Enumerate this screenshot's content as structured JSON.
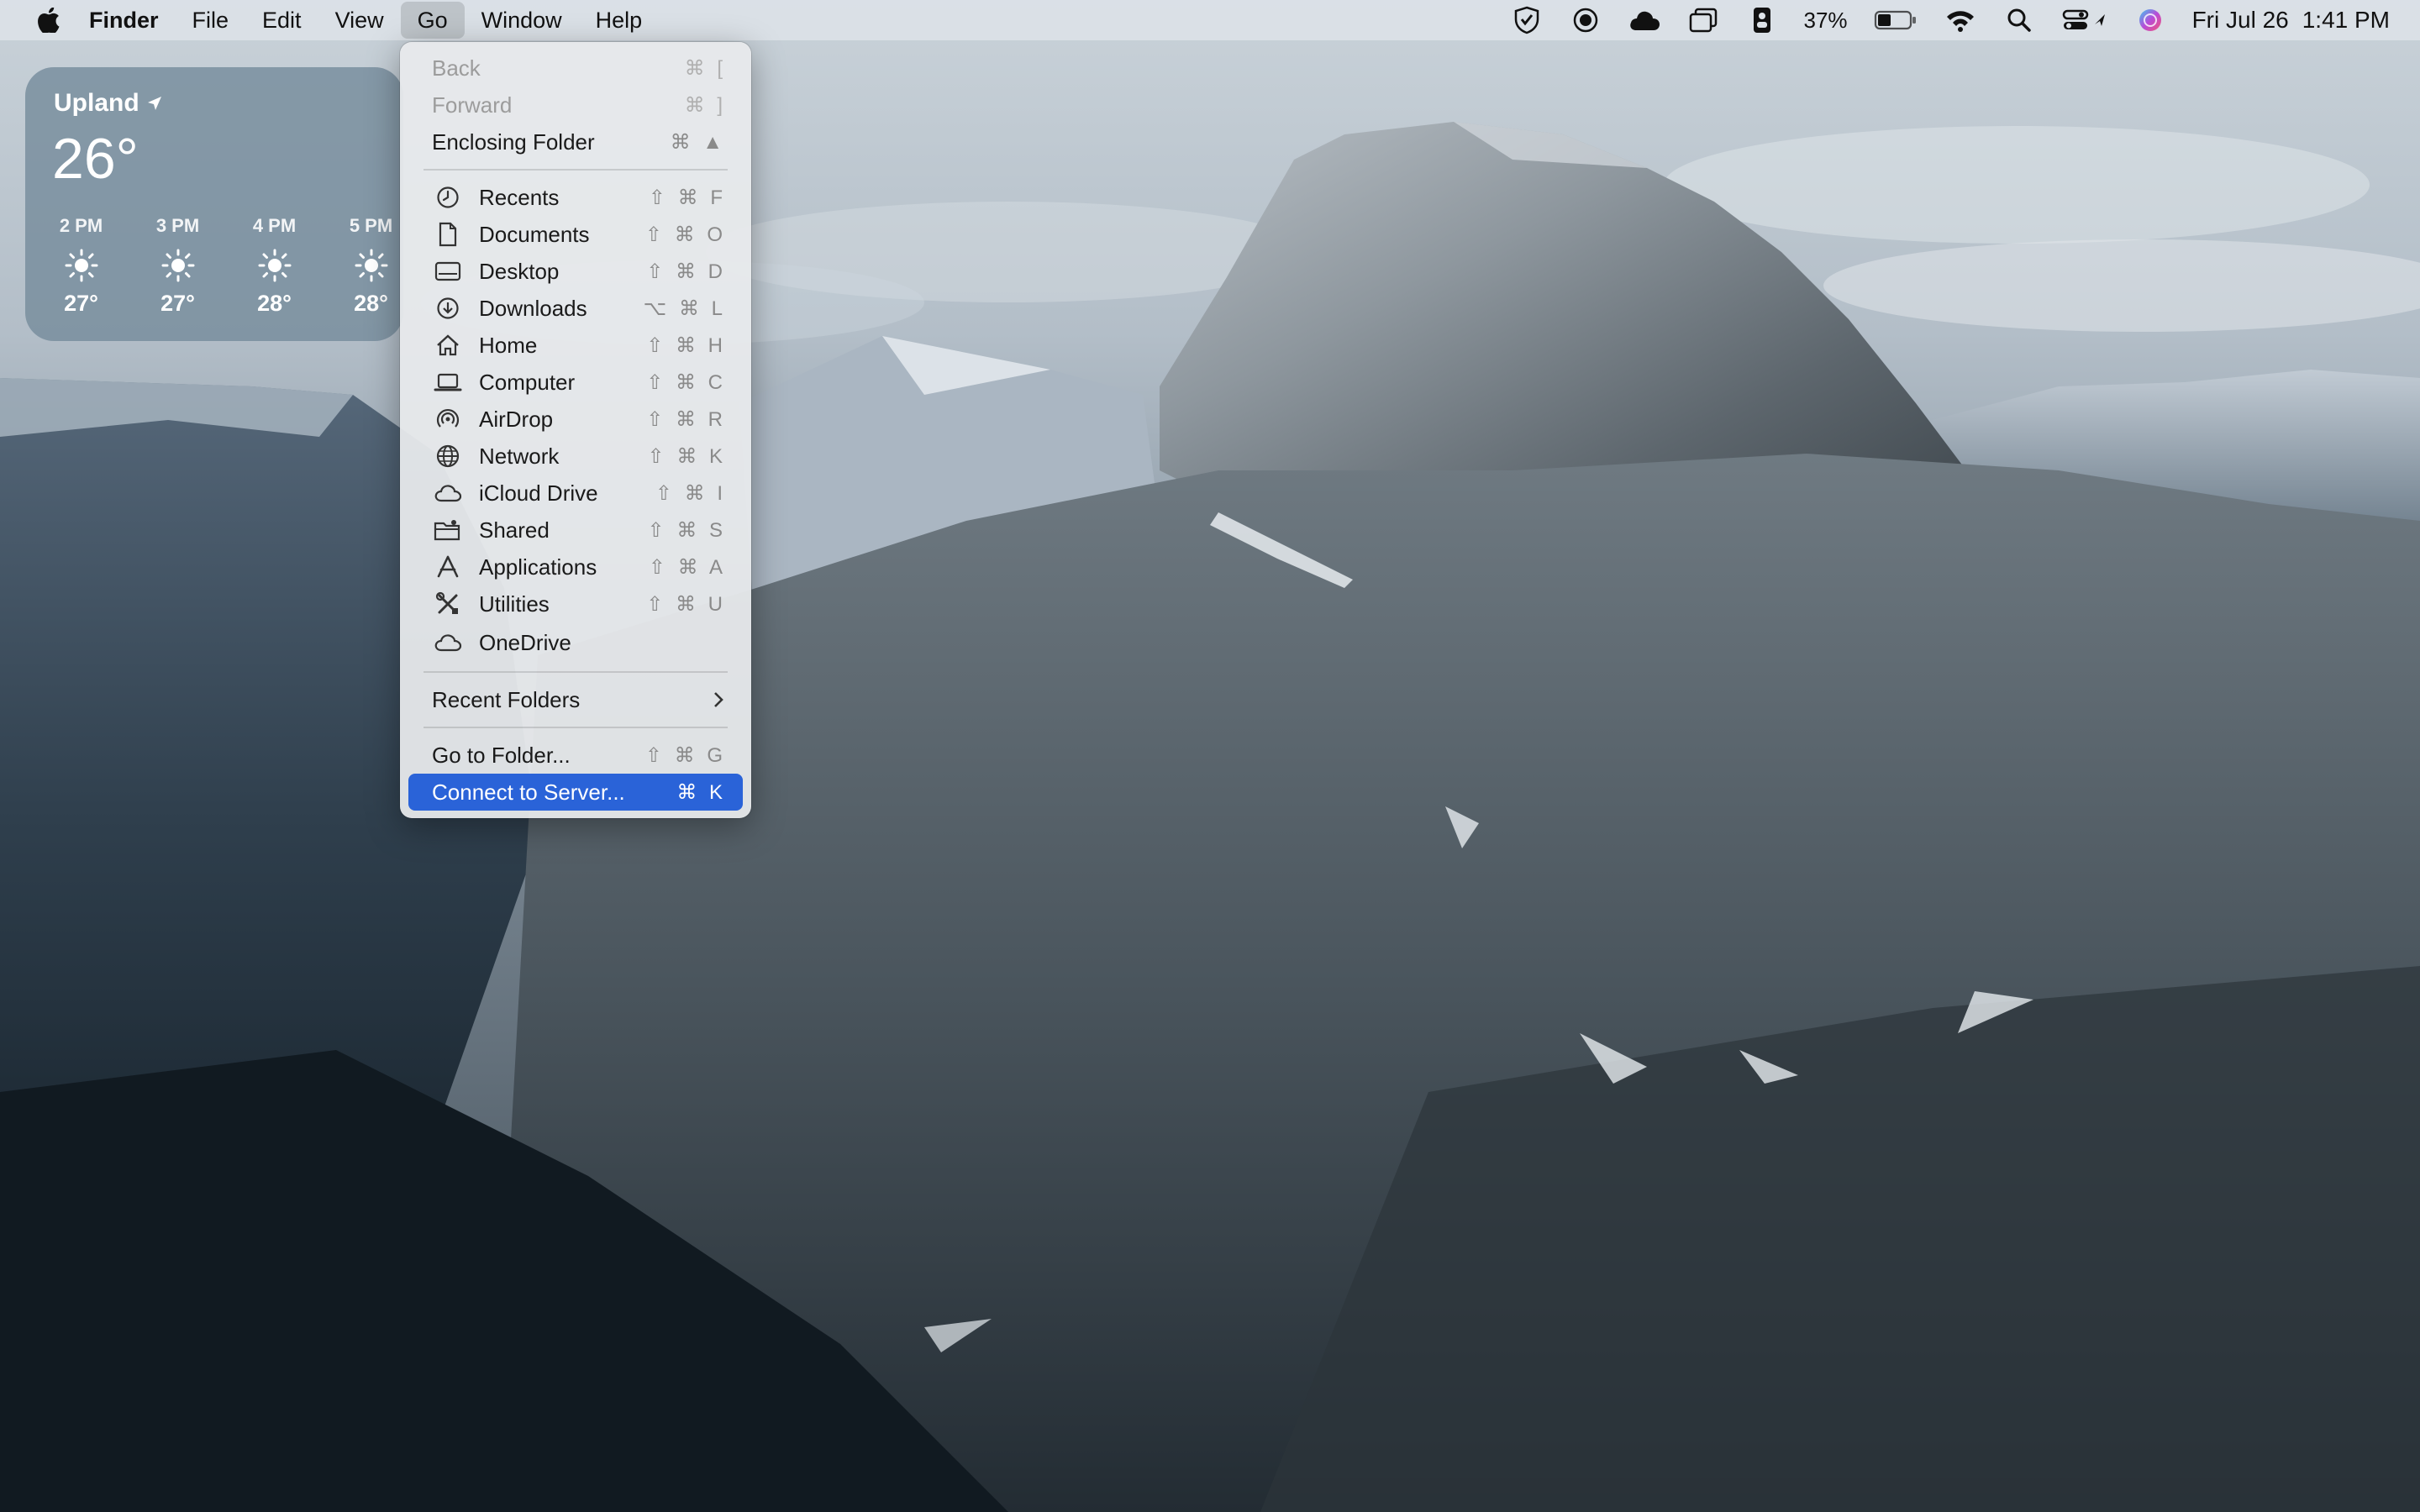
{
  "menubar": {
    "app_name": "Finder",
    "menus": [
      "File",
      "Edit",
      "View",
      "Go",
      "Window",
      "Help"
    ],
    "battery_percent": "37%",
    "date": "Fri Jul 26",
    "time": "1:41 PM"
  },
  "weather": {
    "city": "Upland",
    "current_temp": "26°",
    "forecast": [
      {
        "time": "2 PM",
        "temp": "27°",
        "icon": "sun-icon"
      },
      {
        "time": "3 PM",
        "temp": "27°",
        "icon": "sun-icon"
      },
      {
        "time": "4 PM",
        "temp": "28°",
        "icon": "sun-icon"
      },
      {
        "time": "5 PM",
        "temp": "28°",
        "icon": "sun-icon"
      }
    ]
  },
  "go_menu": {
    "back": {
      "label": "Back",
      "shortcut": "⌘ ["
    },
    "forward": {
      "label": "Forward",
      "shortcut": "⌘ ]"
    },
    "enclosing": {
      "label": "Enclosing Folder",
      "shortcut": "⌘ ▲"
    },
    "places": [
      {
        "label": "Recents",
        "shortcut": "⇧ ⌘ F",
        "icon": "clock-icon"
      },
      {
        "label": "Documents",
        "shortcut": "⇧ ⌘ O",
        "icon": "document-icon"
      },
      {
        "label": "Desktop",
        "shortcut": "⇧ ⌘ D",
        "icon": "desktop-icon"
      },
      {
        "label": "Downloads",
        "shortcut": "⌥ ⌘ L",
        "icon": "download-icon"
      },
      {
        "label": "Home",
        "shortcut": "⇧ ⌘ H",
        "icon": "home-icon"
      },
      {
        "label": "Computer",
        "shortcut": "⇧ ⌘ C",
        "icon": "laptop-icon"
      },
      {
        "label": "AirDrop",
        "shortcut": "⇧ ⌘ R",
        "icon": "airdrop-icon"
      },
      {
        "label": "Network",
        "shortcut": "⇧ ⌘ K",
        "icon": "globe-icon"
      },
      {
        "label": "iCloud Drive",
        "shortcut": "⇧ ⌘ I",
        "icon": "cloud-icon"
      },
      {
        "label": "Shared",
        "shortcut": "⇧ ⌘ S",
        "icon": "shared-folder-icon"
      },
      {
        "label": "Applications",
        "shortcut": "⇧ ⌘ A",
        "icon": "applications-icon"
      },
      {
        "label": "Utilities",
        "shortcut": "⇧ ⌘ U",
        "icon": "utilities-icon"
      },
      {
        "label": "OneDrive",
        "shortcut": "",
        "icon": "cloud-icon"
      }
    ],
    "recent_folders": {
      "label": "Recent Folders"
    },
    "go_to_folder": {
      "label": "Go to Folder...",
      "shortcut": "⇧ ⌘ G"
    },
    "connect": {
      "label": "Connect to Server...",
      "shortcut": "⌘ K"
    }
  },
  "colors": {
    "highlight": "#2a63d8"
  }
}
